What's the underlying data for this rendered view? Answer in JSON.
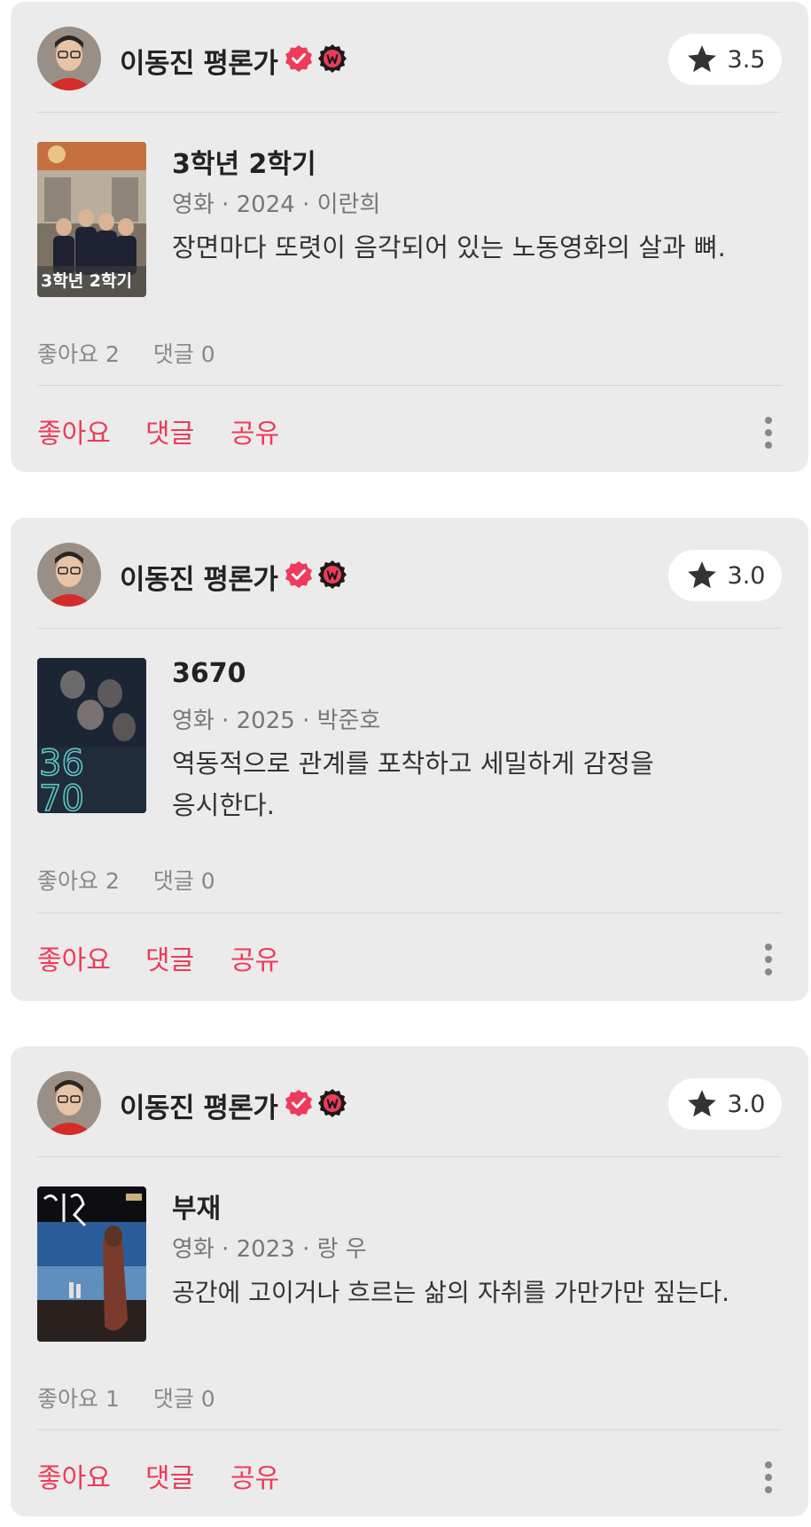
{
  "accent_color": "#ee3b5a",
  "reviews": [
    {
      "reviewer": "이동진 평론가",
      "badges": [
        "verified-check-icon",
        "watcha-w-icon"
      ],
      "rating": "3.5",
      "movie_title": "3학년 2학기",
      "meta": "영화 · 2024 · 이란희",
      "comment": "장면마다 또렷이 음각되어 있는 노동영화의 살과 뼈.",
      "poster_text": "3학년 2학기",
      "likes": "좋아요 2",
      "comments": "댓글 0",
      "like_label": "좋아요",
      "comment_label": "댓글",
      "share_label": "공유"
    },
    {
      "reviewer": "이동진 평론가",
      "badges": [
        "verified-check-icon",
        "watcha-w-icon"
      ],
      "rating": "3.0",
      "movie_title": "3670",
      "meta": "영화 · 2025 · 박준호",
      "comment": "역동적으로 관계를 포착하고 세밀하게 감정을 응시한다.",
      "poster_text_top": "36",
      "poster_text_bottom": "70",
      "likes": "좋아요 2",
      "comments": "댓글 0",
      "like_label": "좋아요",
      "comment_label": "댓글",
      "share_label": "공유"
    },
    {
      "reviewer": "이동진 평론가",
      "badges": [
        "verified-check-icon",
        "watcha-w-icon"
      ],
      "rating": "3.0",
      "movie_title": "부재",
      "meta": "영화 · 2023 · 랑 우",
      "comment": "공간에 고이거나 흐르는 삶의 자취를 가만가만 짚는다.",
      "likes": "좋아요 1",
      "comments": "댓글 0",
      "like_label": "좋아요",
      "comment_label": "댓글",
      "share_label": "공유"
    }
  ]
}
